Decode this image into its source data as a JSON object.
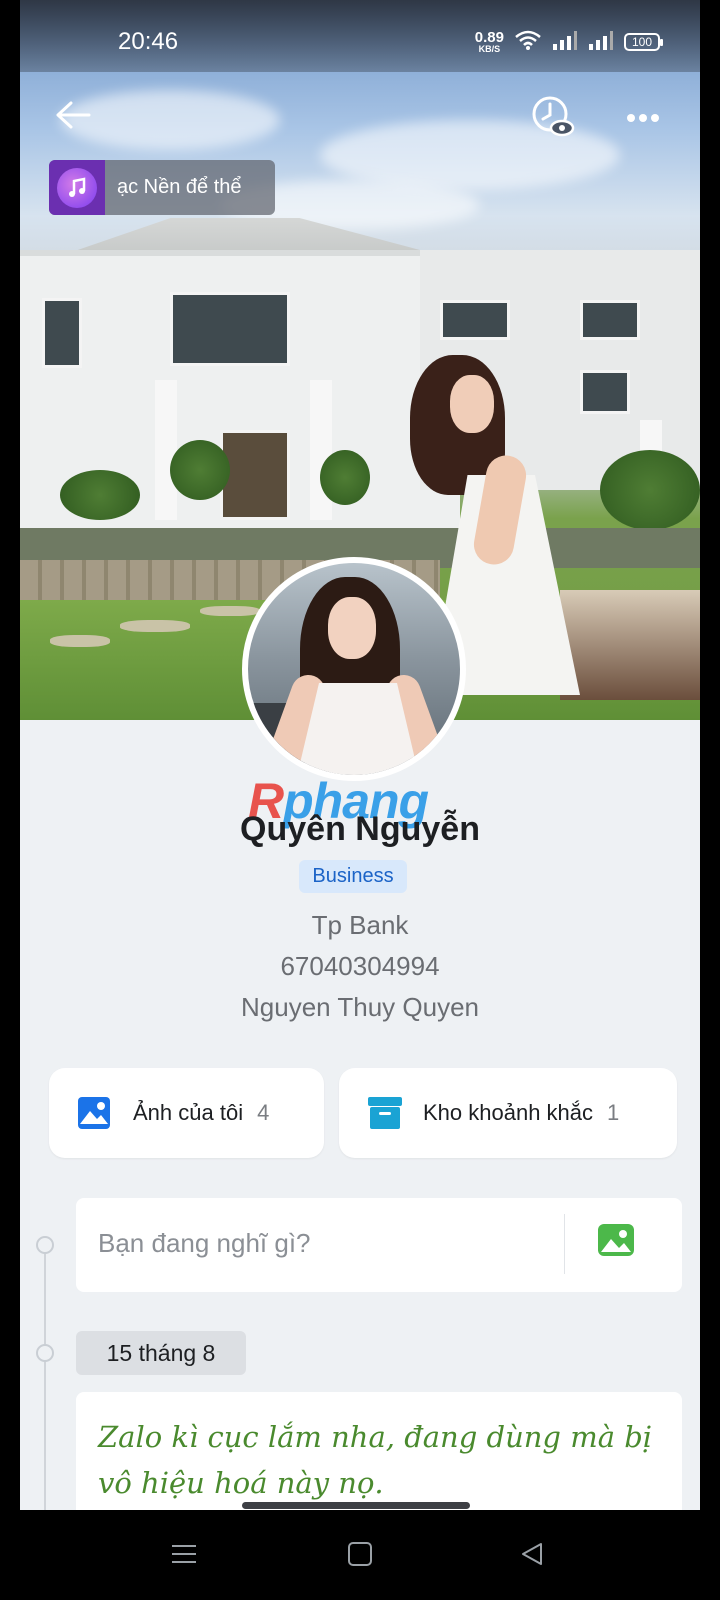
{
  "status_bar": {
    "time": "20:46",
    "net_speed_value": "0.89",
    "net_speed_unit": "KB/S",
    "battery": "100"
  },
  "top_bar": {
    "back_icon": "arrow-left-icon",
    "history_icon": "clock-eye-icon",
    "more_icon": "more-horizontal-icon"
  },
  "music": {
    "label": "ạc Nền để thể",
    "icon": "music-note-icon"
  },
  "watermark": {
    "first": "R",
    "rest": "phang"
  },
  "profile": {
    "name": "Quyên Nguyễn",
    "badge": "Business",
    "bio": {
      "line1": "Tp Bank",
      "line2": "67040304994",
      "line3": "Nguyen Thuy Quyen"
    }
  },
  "quick_links": [
    {
      "label": "Ảnh của tôi",
      "count": "4",
      "icon": "photo-icon"
    },
    {
      "label": "Kho khoảnh khắc",
      "count": "1",
      "icon": "archive-box-icon"
    }
  ],
  "composer": {
    "placeholder": "Bạn đang nghĩ gì?",
    "icon": "image-icon"
  },
  "timeline": {
    "date": "15 tháng 8",
    "post_text": "Zalo kì cục lắm nha, đang dùng mà bị vô hiệu hoá này nọ."
  },
  "colors": {
    "accent_blue": "#1b63c7",
    "badge_bg": "#d8e8fb",
    "post_text_green": "#4a8a2e",
    "page_bg": "#eef1f4"
  },
  "nav_bar": {
    "menu_icon": "menu-icon",
    "home_icon": "square-home-icon",
    "back_icon": "triangle-back-icon"
  }
}
